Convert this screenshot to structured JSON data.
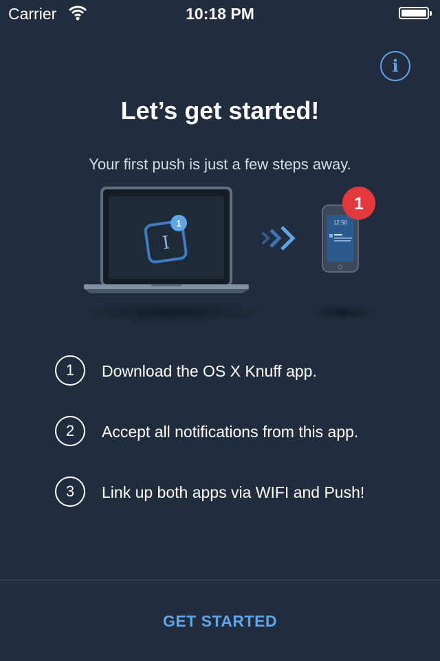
{
  "status_bar": {
    "carrier": "Carrier",
    "time": "10:18 PM"
  },
  "header": {
    "info_icon": "i",
    "title": "Let’s get started!",
    "subtitle": "Your first push is just a few steps away."
  },
  "illustration": {
    "app_badge": "1",
    "phone_badge": "1",
    "phone_clock": "12:50"
  },
  "steps": [
    {
      "number": "1",
      "text": "Download the OS X Knuff app."
    },
    {
      "number": "2",
      "text": "Accept all notifications from this app."
    },
    {
      "number": "3",
      "text": "Link up both apps via WIFI and Push!"
    }
  ],
  "footer": {
    "button_label": "GET STARTED"
  },
  "colors": {
    "background": "#212d3e",
    "accent": "#5fa6e8",
    "badge": "#e5383b"
  }
}
